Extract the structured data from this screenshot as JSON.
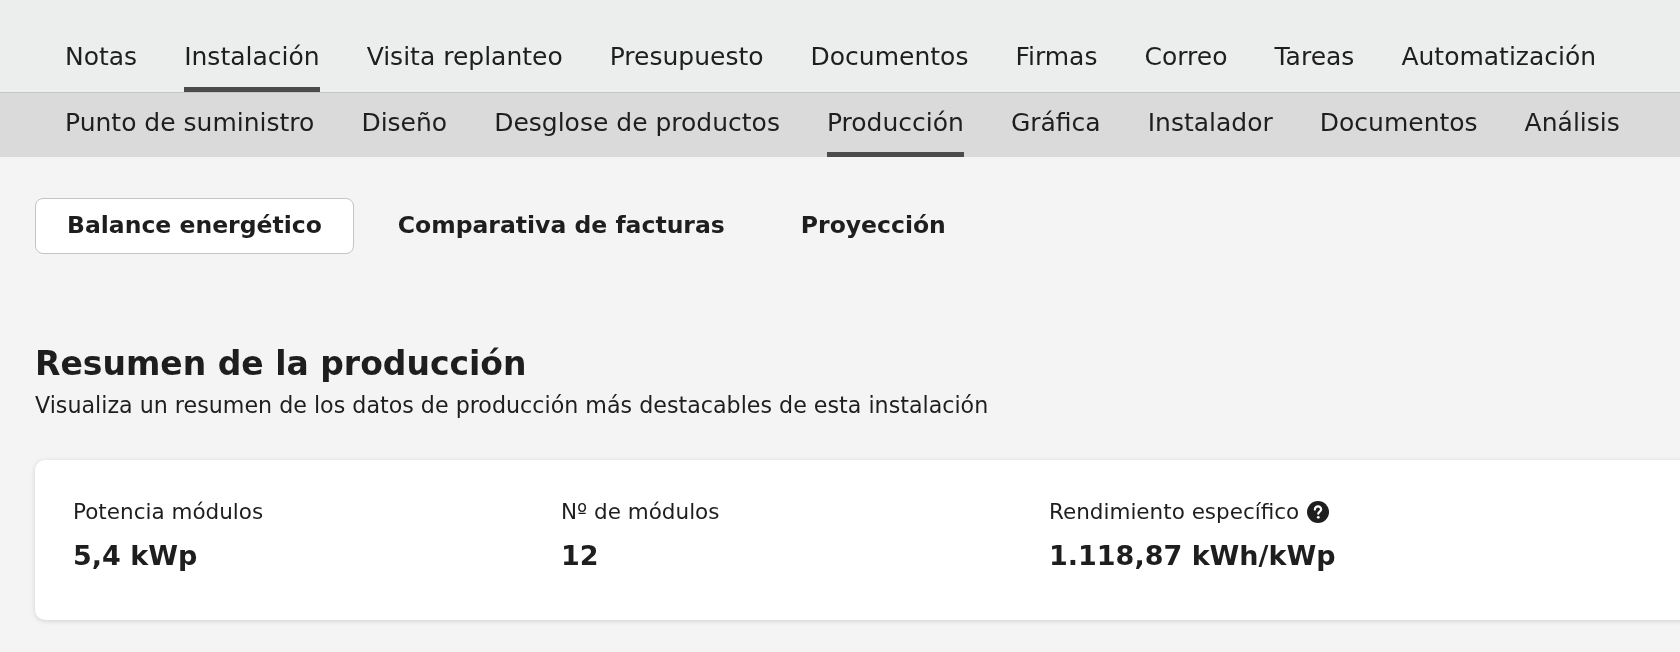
{
  "main_tabs": [
    {
      "label": "Notas",
      "selected": false
    },
    {
      "label": "Instalación",
      "selected": true
    },
    {
      "label": "Visita replanteo",
      "selected": false
    },
    {
      "label": "Presupuesto",
      "selected": false
    },
    {
      "label": "Documentos",
      "selected": false
    },
    {
      "label": "Firmas",
      "selected": false
    },
    {
      "label": "Correo",
      "selected": false
    },
    {
      "label": "Tareas",
      "selected": false
    },
    {
      "label": "Automatización",
      "selected": false
    }
  ],
  "sub_tabs": [
    {
      "label": "Punto de suministro",
      "selected": false
    },
    {
      "label": "Diseño",
      "selected": false
    },
    {
      "label": "Desglose de productos",
      "selected": false
    },
    {
      "label": "Producción",
      "selected": true
    },
    {
      "label": "Gráfica",
      "selected": false
    },
    {
      "label": "Instalador",
      "selected": false
    },
    {
      "label": "Documentos",
      "selected": false
    },
    {
      "label": "Análisis",
      "selected": false
    }
  ],
  "section_tabs": [
    {
      "label": "Balance energético",
      "selected": true
    },
    {
      "label": "Comparativa de facturas",
      "selected": false
    },
    {
      "label": "Proyección",
      "selected": false
    }
  ],
  "summary": {
    "title": "Resumen de la producción",
    "description": "Visualiza un resumen de los datos de producción más destacables de esta instalación",
    "stats": [
      {
        "label": "Potencia módulos",
        "value": "5,4 kWp"
      },
      {
        "label": "Nº de módulos",
        "value": "12"
      },
      {
        "label": "Rendimiento específico",
        "value": "1.118,87 kWh/kWp",
        "help": true
      }
    ]
  }
}
